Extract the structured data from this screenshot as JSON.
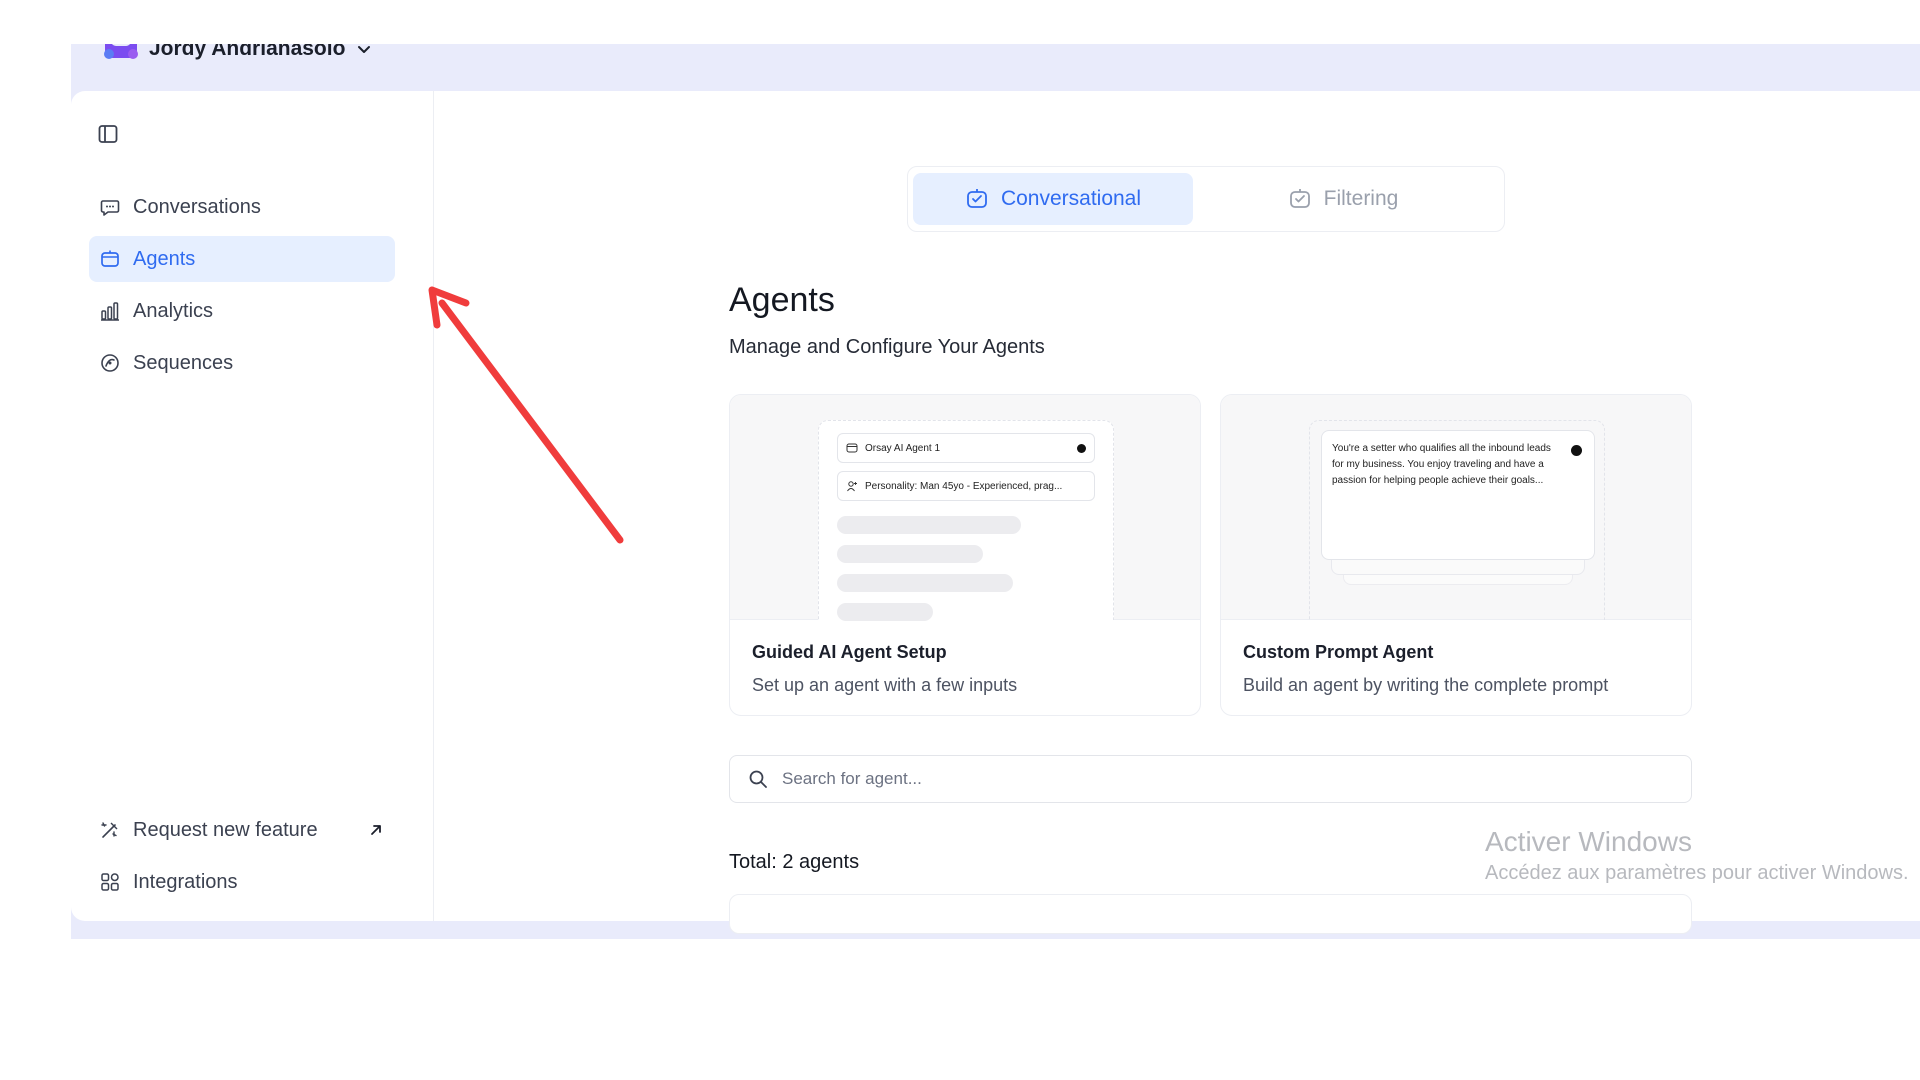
{
  "header": {
    "user_name": "Jordy Andrianasolo",
    "avatar_icon": "avatar-icon",
    "dropdown_icon": "chevron-down-icon"
  },
  "sidebar": {
    "collapse_icon": "sidebar-toggle-icon",
    "items": [
      {
        "label": "Conversations",
        "icon": "chat-icon",
        "active": false
      },
      {
        "label": "Agents",
        "icon": "agent-icon",
        "active": true
      },
      {
        "label": "Analytics",
        "icon": "bar-chart-icon",
        "active": false
      },
      {
        "label": "Sequences",
        "icon": "sequence-icon",
        "active": false
      }
    ],
    "bottom_items": [
      {
        "label": "Request new feature",
        "icon": "magic-wand-icon",
        "external_icon": "arrow-up-right-icon"
      },
      {
        "label": "Integrations",
        "icon": "grid-icon"
      }
    ]
  },
  "tabs": [
    {
      "label": "Conversational",
      "icon": "robot-icon",
      "active": true
    },
    {
      "label": "Filtering",
      "icon": "robot-icon",
      "active": false
    }
  ],
  "main": {
    "title": "Agents",
    "subtitle": "Manage and Configure Your Agents",
    "cards": [
      {
        "title": "Guided AI Agent Setup",
        "description": "Set up an agent with a few inputs",
        "preview": {
          "agent_name": "Orsay AI Agent 1",
          "personality": "Personality: Man 45yo - Experienced, prag..."
        }
      },
      {
        "title": "Custom Prompt Agent",
        "description": "Build an agent by writing the complete prompt",
        "preview": {
          "prompt_text": "You're a setter who qualifies all the inbound leads for my business. You enjoy traveling and have a passion for helping people achieve their goals..."
        }
      }
    ],
    "search": {
      "placeholder": "Search for agent...",
      "value": "",
      "icon": "search-icon"
    },
    "total": "Total: 2 agents"
  },
  "watermark": {
    "title": "Activer Windows",
    "subtitle": "Accédez aux paramètres pour activer Windows."
  },
  "colors": {
    "accent": "#2f6bf0",
    "active_bg": "#e6efff",
    "frame_bg": "#e9ebfb",
    "annotation": "#f03c3c"
  }
}
